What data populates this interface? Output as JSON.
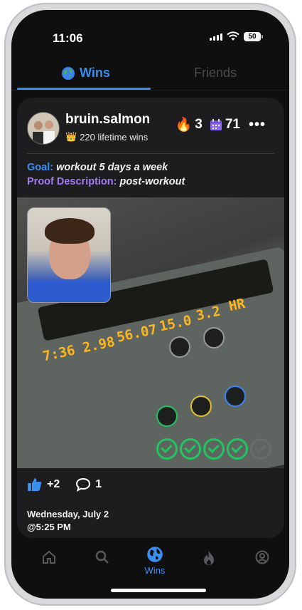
{
  "status": {
    "time": "11:06",
    "battery": "50"
  },
  "tabs": {
    "wins": "Wins",
    "friends": "Friends"
  },
  "post": {
    "username": "bruin.salmon",
    "lifetime_wins": "220 lifetime wins",
    "streak": "3",
    "days": "71",
    "goal_label": "Goal:",
    "goal_value": "workout 5 days a week",
    "proof_label": "Proof Description:",
    "proof_value": "post-workout",
    "likes": "+2",
    "comments": "1",
    "date": "Wednesday, July 2",
    "time": "@5:25 PM"
  },
  "photo_display": {
    "d1": "7:36",
    "d2": "2.98",
    "d3": "56.07",
    "d4": "15.0",
    "d5": "3.2",
    "d6": "HR"
  },
  "nav": {
    "wins_label": "Wins"
  },
  "colors": {
    "accent": "#3a8ef0",
    "purple": "#a27bf2",
    "check": "#22c55e"
  }
}
